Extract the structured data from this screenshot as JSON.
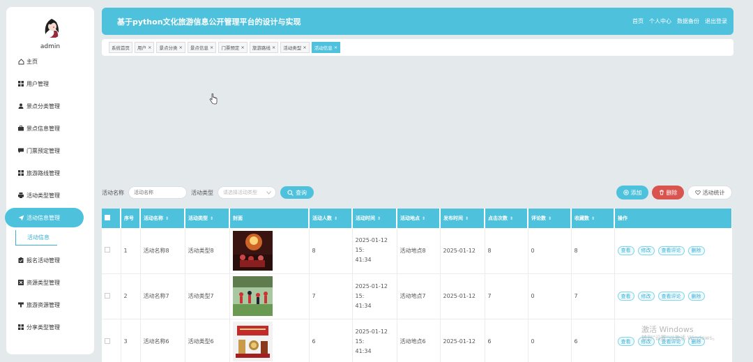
{
  "user": {
    "name": "admin"
  },
  "sidebar": {
    "items": [
      {
        "label": "主页",
        "icon": "home-icon"
      },
      {
        "label": "用户管理",
        "icon": "grid-icon"
      },
      {
        "label": "景点分类管理",
        "icon": "person-icon"
      },
      {
        "label": "景点信息管理",
        "icon": "briefcase-icon"
      },
      {
        "label": "门票预定管理",
        "icon": "chat-icon"
      },
      {
        "label": "旅游路线管理",
        "icon": "grid-icon"
      },
      {
        "label": "活动类型管理",
        "icon": "printer-icon"
      },
      {
        "label": "活动信息管理",
        "icon": "send-icon"
      },
      {
        "label": "报名活动管理",
        "icon": "clipboard-icon"
      },
      {
        "label": "资源类型管理",
        "icon": "close-box-icon"
      },
      {
        "label": "旅游资源管理",
        "icon": "filter-icon"
      },
      {
        "label": "分享类型管理",
        "icon": "grid-icon"
      }
    ],
    "sub_item": "活动信息"
  },
  "header": {
    "title": "基于python文化旅游信息公开管理平台的设计与实现",
    "nav": [
      "首页",
      "个人中心",
      "数据备份",
      "退出登录"
    ]
  },
  "tabs": [
    "系统首页",
    "用户",
    "景点分类",
    "景点信息",
    "门票预定",
    "旅游路线",
    "活动类型",
    "活动信息"
  ],
  "search": {
    "name_label": "活动名称",
    "name_placeholder": "活动名称",
    "type_label": "活动类型",
    "type_placeholder": "请选择活动类型",
    "query_label": "查询"
  },
  "actions": {
    "add": "添加",
    "delete": "删除",
    "stats": "活动统计"
  },
  "table": {
    "headers": [
      "序号",
      "活动名称",
      "活动类型",
      "封面",
      "活动人数",
      "活动时间",
      "活动地点",
      "发布时间",
      "点击次数",
      "评论数",
      "收藏数",
      "操作"
    ],
    "ops": [
      "查看",
      "修改",
      "查看评论",
      "删除"
    ],
    "rows": [
      {
        "index": "1",
        "name": "活动名称8",
        "type": "活动类型8",
        "people": "8",
        "time_a": "2025-01-12 15:",
        "time_b": "41:34",
        "place": "活动地点8",
        "published": "2025-01-12",
        "clicks": "8",
        "comments": "0",
        "favorites": "8"
      },
      {
        "index": "2",
        "name": "活动名称7",
        "type": "活动类型7",
        "people": "7",
        "time_a": "2025-01-12 15:",
        "time_b": "41:34",
        "place": "活动地点7",
        "published": "2025-01-12",
        "clicks": "7",
        "comments": "0",
        "favorites": "7"
      },
      {
        "index": "3",
        "name": "活动名称6",
        "type": "活动类型6",
        "people": "6",
        "time_a": "2025-01-12 15:",
        "time_b": "41:34",
        "place": "活动地点6",
        "published": "2025-01-12",
        "clicks": "6",
        "comments": "0",
        "favorites": "6"
      }
    ]
  },
  "watermark": {
    "line1": "激活 Windows",
    "line2": "转到\"设置\"以激活 Windows。"
  },
  "colors": {
    "accent": "#4ec1dd",
    "danger": "#d9534f",
    "background": "#e4e9ec"
  }
}
